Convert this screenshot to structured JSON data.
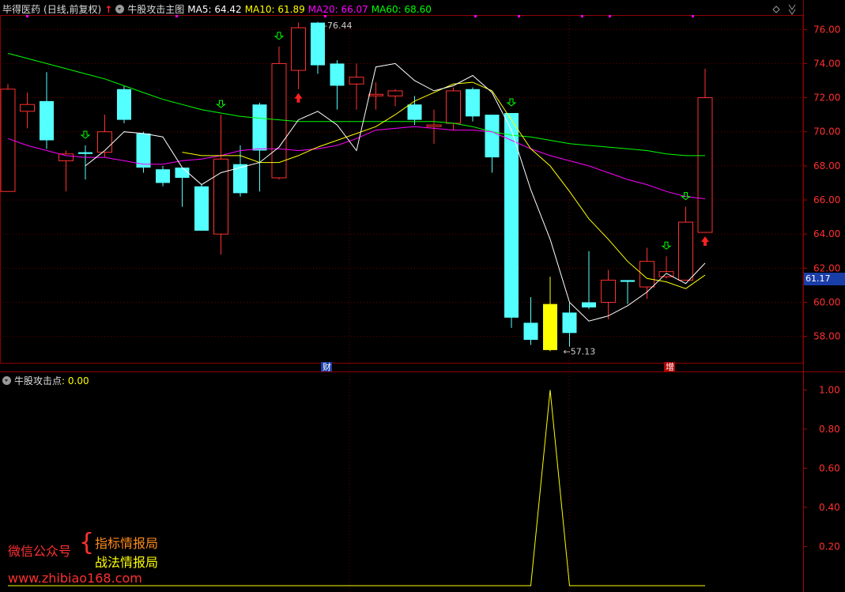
{
  "header": {
    "stock_name": "毕得医药",
    "period": "(日线,前复权)",
    "indicator": "牛股攻击主图",
    "ma5": "MA5: 64.42",
    "ma10": "MA10: 61.89",
    "ma20": "MA20: 66.07",
    "ma60": "MA60: 68.60",
    "colors": {
      "ma5": "#ffffff",
      "ma10": "#ffff00",
      "ma20": "#ff00ff",
      "ma60": "#00ff00"
    }
  },
  "price_axis": [
    "76.00",
    "74.00",
    "72.00",
    "70.00",
    "68.00",
    "66.00",
    "64.00",
    "62.00",
    "60.00",
    "58.00"
  ],
  "current_price_badge": "61.17",
  "annotations": {
    "high": "76.44",
    "low": "57.13",
    "mark_cai": "财",
    "mark_zeng": "增"
  },
  "sub_panel": {
    "title": "牛股攻击点",
    "value": ": 0.00",
    "axis": [
      "1.00",
      "0.80",
      "0.60",
      "0.40",
      "0.20"
    ]
  },
  "watermark": {
    "label": "微信公众号",
    "line1": "指标情报局",
    "line2": "战法情报局",
    "url": "www.zhibiao168.com"
  },
  "chart_data": {
    "type": "candlestick",
    "y_range": [
      56.5,
      76.8
    ],
    "candles": [
      {
        "o": 66.5,
        "c": 72.5,
        "h": 72.8,
        "l": 66.5
      },
      {
        "o": 71.2,
        "c": 71.6,
        "h": 72.3,
        "l": 70.2
      },
      {
        "o": 71.8,
        "c": 69.5,
        "h": 73.5,
        "l": 69.0
      },
      {
        "o": 68.3,
        "c": 68.7,
        "h": 68.9,
        "l": 66.5
      },
      {
        "o": 68.8,
        "c": 68.7,
        "h": 69.2,
        "l": 67.2
      },
      {
        "o": 68.8,
        "c": 70.0,
        "h": 71.0,
        "l": 68.5
      },
      {
        "o": 72.5,
        "c": 70.7,
        "h": 72.7,
        "l": 70.5
      },
      {
        "o": 69.9,
        "c": 67.9,
        "h": 70.0,
        "l": 67.6
      },
      {
        "o": 67.8,
        "c": 67.0,
        "h": 68.0,
        "l": 66.8
      },
      {
        "o": 67.9,
        "c": 67.3,
        "h": 67.9,
        "l": 65.6
      },
      {
        "o": 66.8,
        "c": 64.2,
        "h": 66.9,
        "l": 64.2
      },
      {
        "o": 64.0,
        "c": 68.4,
        "h": 71.0,
        "l": 62.8
      },
      {
        "o": 68.1,
        "c": 66.4,
        "h": 69.2,
        "l": 66.2
      },
      {
        "o": 71.6,
        "c": 68.9,
        "h": 71.7,
        "l": 66.5
      },
      {
        "o": 67.3,
        "c": 74.0,
        "h": 75.0,
        "l": 67.2
      },
      {
        "o": 73.6,
        "c": 76.1,
        "h": 76.4,
        "l": 72.5
      },
      {
        "o": 76.4,
        "c": 73.9,
        "h": 76.44,
        "l": 73.4
      },
      {
        "o": 74.0,
        "c": 72.7,
        "h": 74.2,
        "l": 71.3
      },
      {
        "o": 72.8,
        "c": 73.2,
        "h": 74.0,
        "l": 71.3
      },
      {
        "o": 72.2,
        "c": 72.2,
        "h": 72.9,
        "l": 71.3
      },
      {
        "o": 72.1,
        "c": 72.4,
        "h": 72.5,
        "l": 71.5
      },
      {
        "o": 71.6,
        "c": 70.7,
        "h": 72.1,
        "l": 70.4
      },
      {
        "o": 70.4,
        "c": 70.4,
        "h": 71.3,
        "l": 69.3
      },
      {
        "o": 70.5,
        "c": 72.4,
        "h": 72.6,
        "l": 70.1
      },
      {
        "o": 72.5,
        "c": 70.9,
        "h": 72.6,
        "l": 70.6
      },
      {
        "o": 71.0,
        "c": 68.5,
        "h": 71.0,
        "l": 67.6
      },
      {
        "o": 71.1,
        "c": 59.1,
        "h": 71.1,
        "l": 58.5
      },
      {
        "o": 58.8,
        "c": 57.8,
        "h": 60.3,
        "l": 57.5
      },
      {
        "o": 57.2,
        "c": 59.9,
        "h": 61.5,
        "l": 57.13
      },
      {
        "o": 59.4,
        "c": 58.2,
        "h": 60.0,
        "l": 57.4
      },
      {
        "o": 60.0,
        "c": 59.7,
        "h": 63.0,
        "l": 59.6
      },
      {
        "o": 60.0,
        "c": 61.3,
        "h": 61.9,
        "l": 59.0
      },
      {
        "o": 61.3,
        "c": 61.2,
        "h": 61.3,
        "l": 59.9
      },
      {
        "o": 60.9,
        "c": 62.4,
        "h": 63.2,
        "l": 60.2
      },
      {
        "o": 61.5,
        "c": 61.8,
        "h": 62.7,
        "l": 61.4
      },
      {
        "o": 61.3,
        "c": 64.7,
        "h": 65.6,
        "l": 61.3
      },
      {
        "o": 64.1,
        "c": 72.0,
        "h": 73.7,
        "l": 64.1
      }
    ],
    "ma5": [
      null,
      null,
      null,
      null,
      68.0,
      68.9,
      70.0,
      69.9,
      69.7,
      67.9,
      66.9,
      67.6,
      67.9,
      68.2,
      69.1,
      70.7,
      71.2,
      70.4,
      68.9,
      73.8,
      74.0,
      73.0,
      72.4,
      72.7,
      73.3,
      72.3,
      70.1,
      66.6,
      63.7,
      60.0,
      58.9,
      59.2,
      59.8,
      60.6,
      61.7,
      61.1,
      62.3
    ],
    "ma10": [
      null,
      null,
      null,
      null,
      null,
      null,
      null,
      null,
      null,
      68.8,
      68.6,
      68.6,
      68.6,
      68.2,
      68.2,
      68.6,
      69.1,
      69.5,
      69.9,
      70.3,
      71.0,
      71.8,
      72.3,
      72.8,
      72.9,
      72.4,
      70.7,
      69.0,
      68.0,
      66.5,
      64.9,
      63.7,
      62.4,
      61.4,
      61.2,
      60.8,
      61.6
    ],
    "ma20": [
      69.6,
      69.2,
      68.9,
      68.6,
      68.5,
      68.5,
      68.3,
      68.1,
      68.1,
      68.3,
      68.4,
      68.6,
      68.9,
      69.0,
      69.0,
      68.9,
      69.0,
      69.2,
      69.6,
      70.1,
      70.2,
      70.3,
      70.2,
      70.1,
      70.1,
      70.0,
      69.5,
      69.0,
      68.6,
      68.3,
      68.0,
      67.6,
      67.2,
      66.9,
      66.5,
      66.2,
      66.07
    ],
    "ma60": [
      74.6,
      74.3,
      74.0,
      73.7,
      73.4,
      73.1,
      72.7,
      72.3,
      71.9,
      71.6,
      71.3,
      71.1,
      70.9,
      70.8,
      70.7,
      70.6,
      70.6,
      70.6,
      70.6,
      70.6,
      70.6,
      70.6,
      70.6,
      70.5,
      70.3,
      70.0,
      69.8,
      69.7,
      69.5,
      69.3,
      69.2,
      69.1,
      69.0,
      68.9,
      68.7,
      68.6,
      68.6
    ],
    "sub_series": {
      "name": "牛股攻击点",
      "values": [
        0,
        0,
        0,
        0,
        0,
        0,
        0,
        0,
        0,
        0,
        0,
        0,
        0,
        0,
        0,
        0,
        0,
        0,
        0,
        0,
        0,
        0,
        0,
        0,
        0,
        0,
        0,
        0,
        1,
        0,
        0,
        0,
        0,
        0,
        0,
        0,
        0
      ],
      "y_range": [
        0,
        1.05
      ]
    },
    "up_arrows": [
      15,
      36
    ],
    "down_arrows": [
      4,
      11,
      14,
      26,
      34,
      35
    ]
  }
}
